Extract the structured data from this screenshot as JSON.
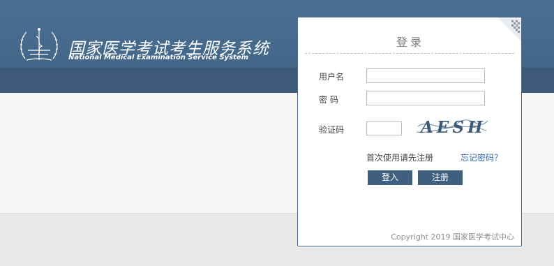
{
  "header": {
    "title": "国家医学考试考生服务系统",
    "subtitle": "National Medical Examination Service System"
  },
  "login": {
    "title": "登录",
    "username_label": "用户名",
    "username_value": "",
    "password_label": "密 码",
    "password_value": "",
    "captcha_label": "验证码",
    "captcha_value": "",
    "captcha_text": "AESH",
    "first_use_text": "首次使用请先注册",
    "forgot_password": "忘记密码？",
    "login_button": "登入",
    "register_button": "注册",
    "copyright": "Copyright 2019 国家医学考试中心"
  },
  "colors": {
    "header": "#45698b",
    "button": "#3e5f80",
    "link": "#2f6aa8"
  },
  "icons": {
    "logo": "medical-emblem-icon",
    "corner": "qr-code-icon"
  }
}
